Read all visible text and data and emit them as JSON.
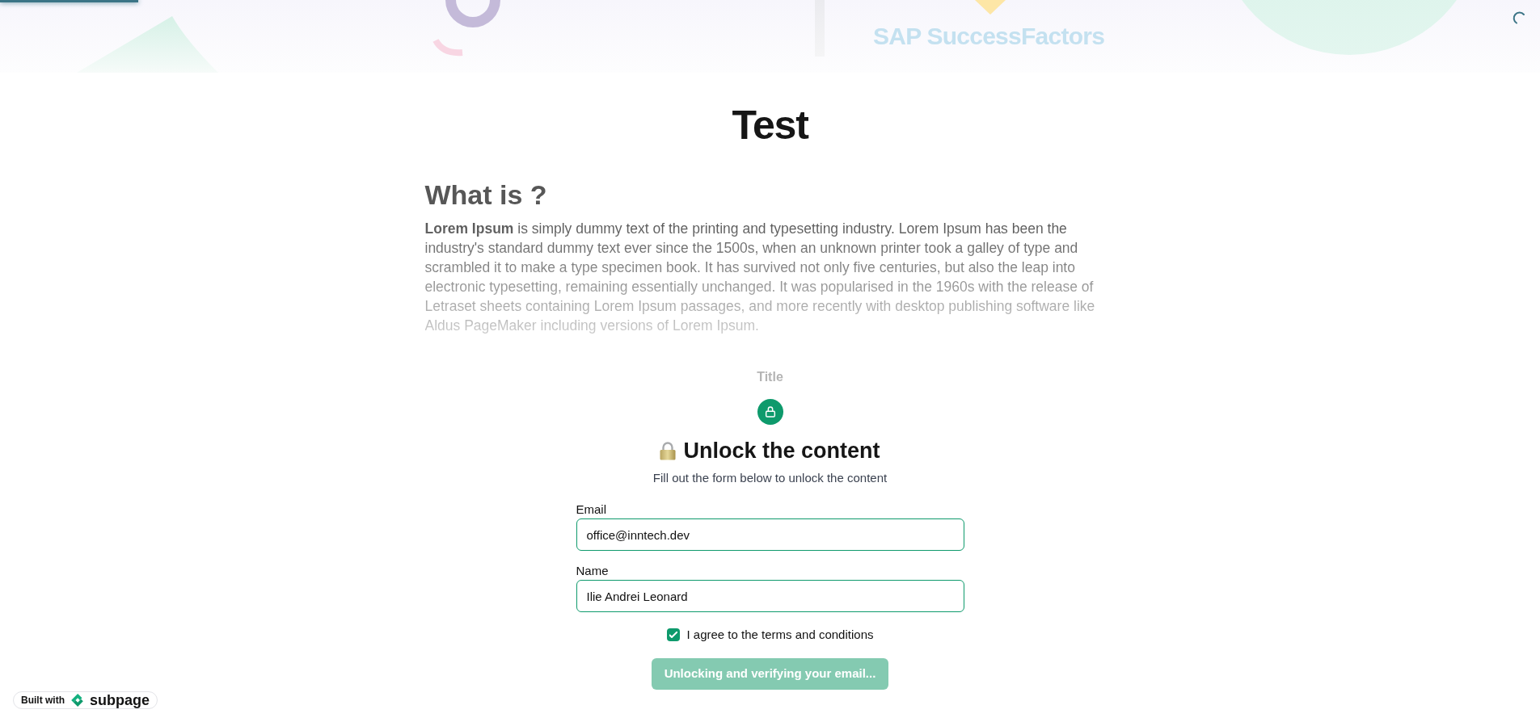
{
  "loading_bar": {
    "level": 0.09
  },
  "banner": {
    "logo_text": "SAP SuccessFactors"
  },
  "article": {
    "title": "Test",
    "heading": "What is ?",
    "body": "**Lorem Ipsum** is simply dummy text of the printing and typesetting industry. Lorem Ipsum has been the industry's standard dummy text ever since the 1500s, when an unknown printer took a galley of type and scrambled it to make a type specimen book. It has survived not only five centuries, but also the leap into electronic typesetting, remaining essentially unchanged. It was popularised in the 1960s with the release of Letraset sheets containing Lorem Ipsum passages, and more recently with desktop publishing software like Aldus PageMaker including versions of Lorem Ipsum."
  },
  "gate": {
    "title": "Title",
    "heading": "Unlock the content",
    "subtitle": "Fill out the form below to unlock the content",
    "fields": [
      {
        "label": "Email",
        "value": "office@inntech.dev"
      },
      {
        "label": "Name",
        "value": "Ilie Andrei Leonard"
      }
    ],
    "terms": {
      "label": "I agree to the terms and conditions",
      "checked": true
    },
    "submit_button": {
      "label": "Unlocking and verifying your email...",
      "disabled": true
    }
  },
  "badge": {
    "prefix": "Built with",
    "brand": "subpage"
  }
}
